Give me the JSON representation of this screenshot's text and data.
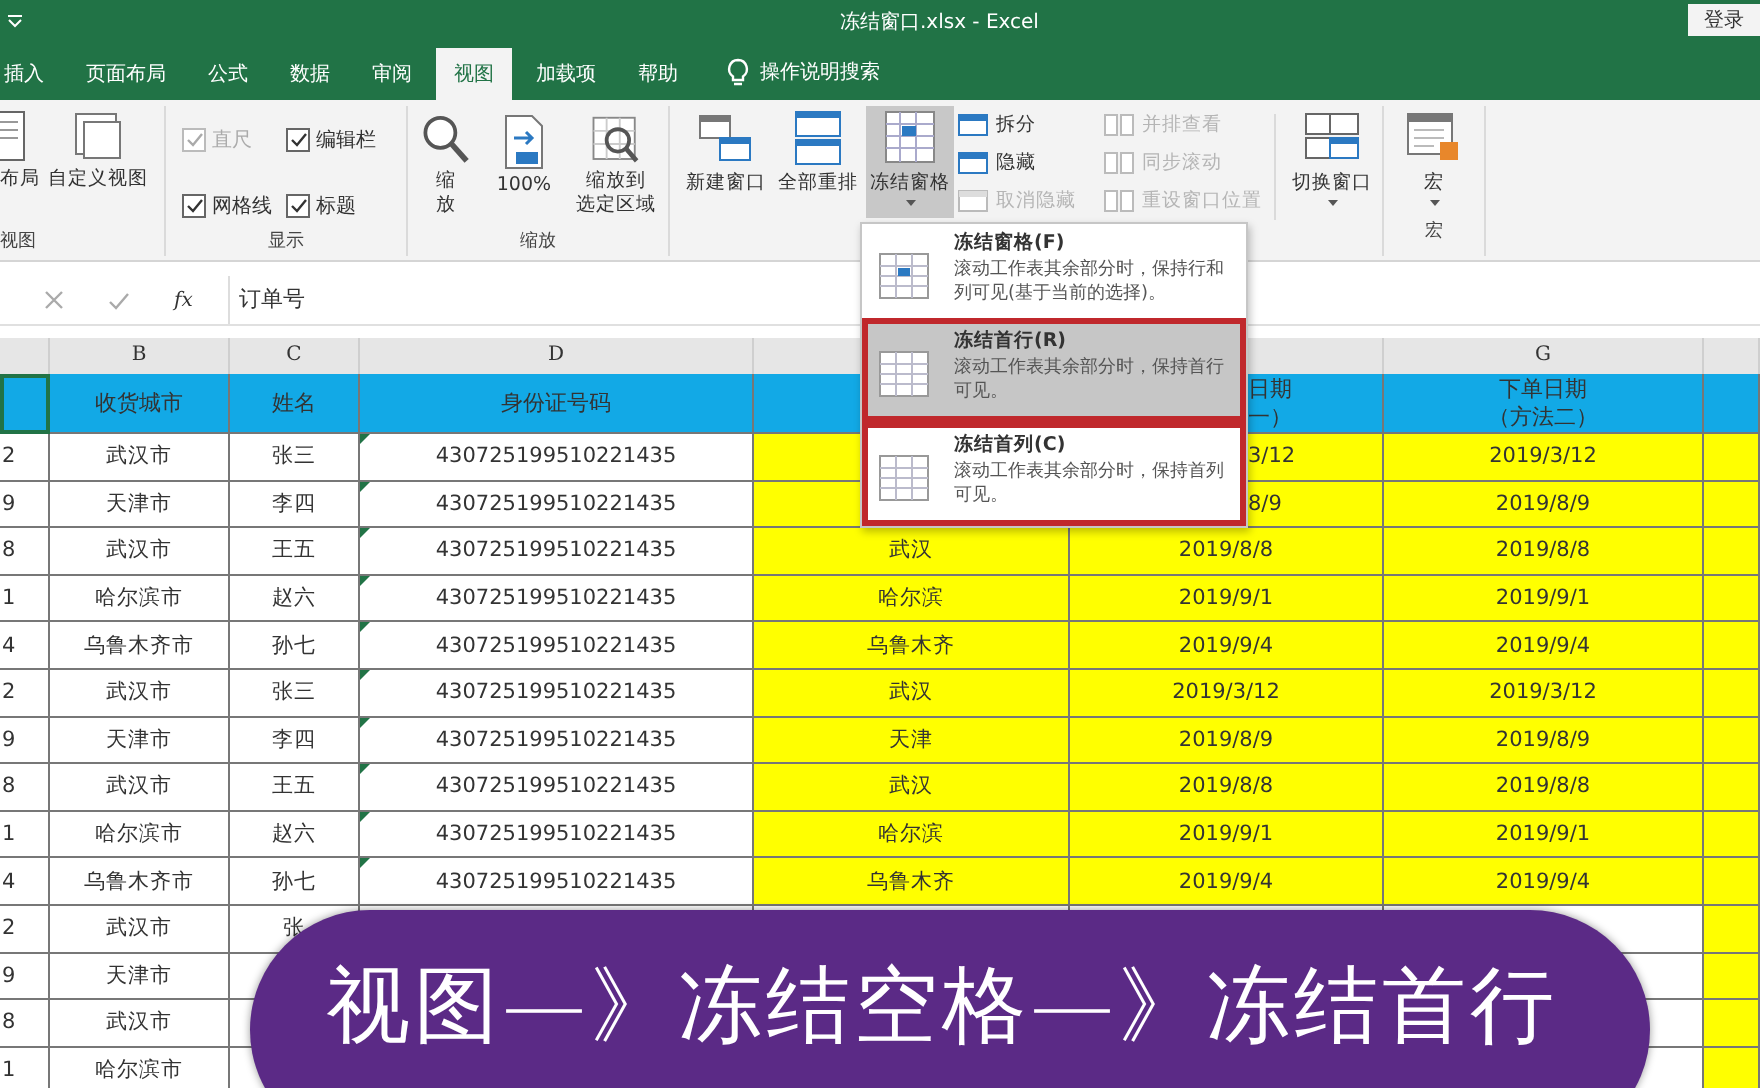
{
  "window": {
    "title": "冻结窗口.xlsx  -  Excel",
    "sign_in": "登录"
  },
  "tabs": [
    {
      "label": "插入",
      "selected": false
    },
    {
      "label": "页面布局",
      "selected": false
    },
    {
      "label": "公式",
      "selected": false
    },
    {
      "label": "数据",
      "selected": false
    },
    {
      "label": "审阅",
      "selected": false
    },
    {
      "label": "视图",
      "selected": true
    },
    {
      "label": "加载项",
      "selected": false
    },
    {
      "label": "帮助",
      "selected": false
    }
  ],
  "tell_me": "操作说明搜索",
  "ribbon": {
    "views": {
      "items": [
        "布局",
        "自定义视图"
      ],
      "label": "视图"
    },
    "show": {
      "checks": [
        {
          "label": "直尺",
          "checked": true,
          "disabled": true
        },
        {
          "label": "编辑栏",
          "checked": true,
          "disabled": false
        },
        {
          "label": "网格线",
          "checked": true,
          "disabled": false
        },
        {
          "label": "标题",
          "checked": true,
          "disabled": false
        }
      ],
      "label": "显示"
    },
    "zoom": {
      "items": [
        [
          "缩",
          "放"
        ],
        [
          "100%"
        ],
        [
          "缩放到",
          "选定区域"
        ]
      ],
      "label": "缩放"
    },
    "window": {
      "large": [
        {
          "label": "新建窗口",
          "pressed": false
        },
        {
          "label": "全部重排",
          "pressed": false
        },
        {
          "label": "冻结窗格",
          "pressed": true
        }
      ],
      "small": [
        {
          "label": "拆分",
          "disabled": false
        },
        {
          "label": "隐藏",
          "disabled": false
        },
        {
          "label": "取消隐藏",
          "disabled": true
        },
        {
          "label": "并排查看",
          "disabled": true
        },
        {
          "label": "同步滚动",
          "disabled": true
        },
        {
          "label": "重设窗口位置",
          "disabled": true
        }
      ],
      "switch": "切换窗口"
    },
    "macro": {
      "button": "宏",
      "label": "宏"
    }
  },
  "freeze_menu": {
    "items": [
      {
        "title": "冻结窗格(F)",
        "description": "滚动工作表其余部分时，保持行和列可见(基于当前的选择)。",
        "selected": false,
        "outlined": false
      },
      {
        "title": "冻结首行(R)",
        "description": "滚动工作表其余部分时，保持首行可见。",
        "selected": true,
        "outlined": true
      },
      {
        "title": "冻结首列(C)",
        "description": "滚动工作表其余部分时，保持首列可见。",
        "selected": false,
        "outlined": true
      }
    ]
  },
  "formula_bar": {
    "function_label": "fx",
    "value": "订单号"
  },
  "sheet": {
    "columns": [
      {
        "selected": true
      },
      {
        "letter": "B",
        "header": [
          "收货城市"
        ],
        "selected": false
      },
      {
        "letter": "C",
        "header": [
          "姓名"
        ],
        "selected": false
      },
      {
        "letter": "D",
        "header": [
          "身份证号码"
        ],
        "selected": false
      },
      {
        "selected": false
      },
      {
        "header": [
          "日期",
          "一）"
        ],
        "selected": false
      },
      {
        "letter": "G",
        "header": [
          "下单日期",
          "（方法二）"
        ],
        "selected": false
      },
      {
        "selected": false
      }
    ],
    "rows": [
      {
        "a": "2",
        "b": "武汉市",
        "c": "张三",
        "d": "430725199510221435",
        "f": "3/12",
        "g": "2019/3/12"
      },
      {
        "a": "9",
        "b": "天津市",
        "c": "李四",
        "d": "430725199510221435",
        "f": "8/9",
        "g": "2019/8/9"
      },
      {
        "a": "8",
        "b": "武汉市",
        "c": "王五",
        "d": "430725199510221435",
        "e": "武汉",
        "f": "2019/8/8",
        "g": "2019/8/8"
      },
      {
        "a": "1",
        "b": "哈尔滨市",
        "c": "赵六",
        "d": "430725199510221435",
        "e": "哈尔滨",
        "f": "2019/9/1",
        "g": "2019/9/1"
      },
      {
        "a": "4",
        "b": "乌鲁木齐市",
        "c": "孙七",
        "d": "430725199510221435",
        "e": "乌鲁木齐",
        "f": "2019/9/4",
        "g": "2019/9/4"
      },
      {
        "a": "2",
        "b": "武汉市",
        "c": "张三",
        "d": "430725199510221435",
        "e": "武汉",
        "f": "2019/3/12",
        "g": "2019/3/12"
      },
      {
        "a": "9",
        "b": "天津市",
        "c": "李四",
        "d": "430725199510221435",
        "e": "天津",
        "f": "2019/8/9",
        "g": "2019/8/9"
      },
      {
        "a": "8",
        "b": "武汉市",
        "c": "王五",
        "d": "430725199510221435",
        "e": "武汉",
        "f": "2019/8/8",
        "g": "2019/8/8"
      },
      {
        "a": "1",
        "b": "哈尔滨市",
        "c": "赵六",
        "d": "430725199510221435",
        "e": "哈尔滨",
        "f": "2019/9/1",
        "g": "2019/9/1"
      },
      {
        "a": "4",
        "b": "乌鲁木齐市",
        "c": "孙七",
        "d": "430725199510221435",
        "e": "乌鲁木齐",
        "f": "2019/9/4",
        "g": "2019/9/4"
      },
      {
        "a": "2",
        "b": "武汉市",
        "c": "张"
      },
      {
        "a": "9",
        "b": "天津市"
      },
      {
        "a": "8",
        "b": "武汉市"
      },
      {
        "a": "1",
        "b": "哈尔滨市"
      }
    ]
  },
  "caption": "视图—》冻结空格—》冻结首行"
}
